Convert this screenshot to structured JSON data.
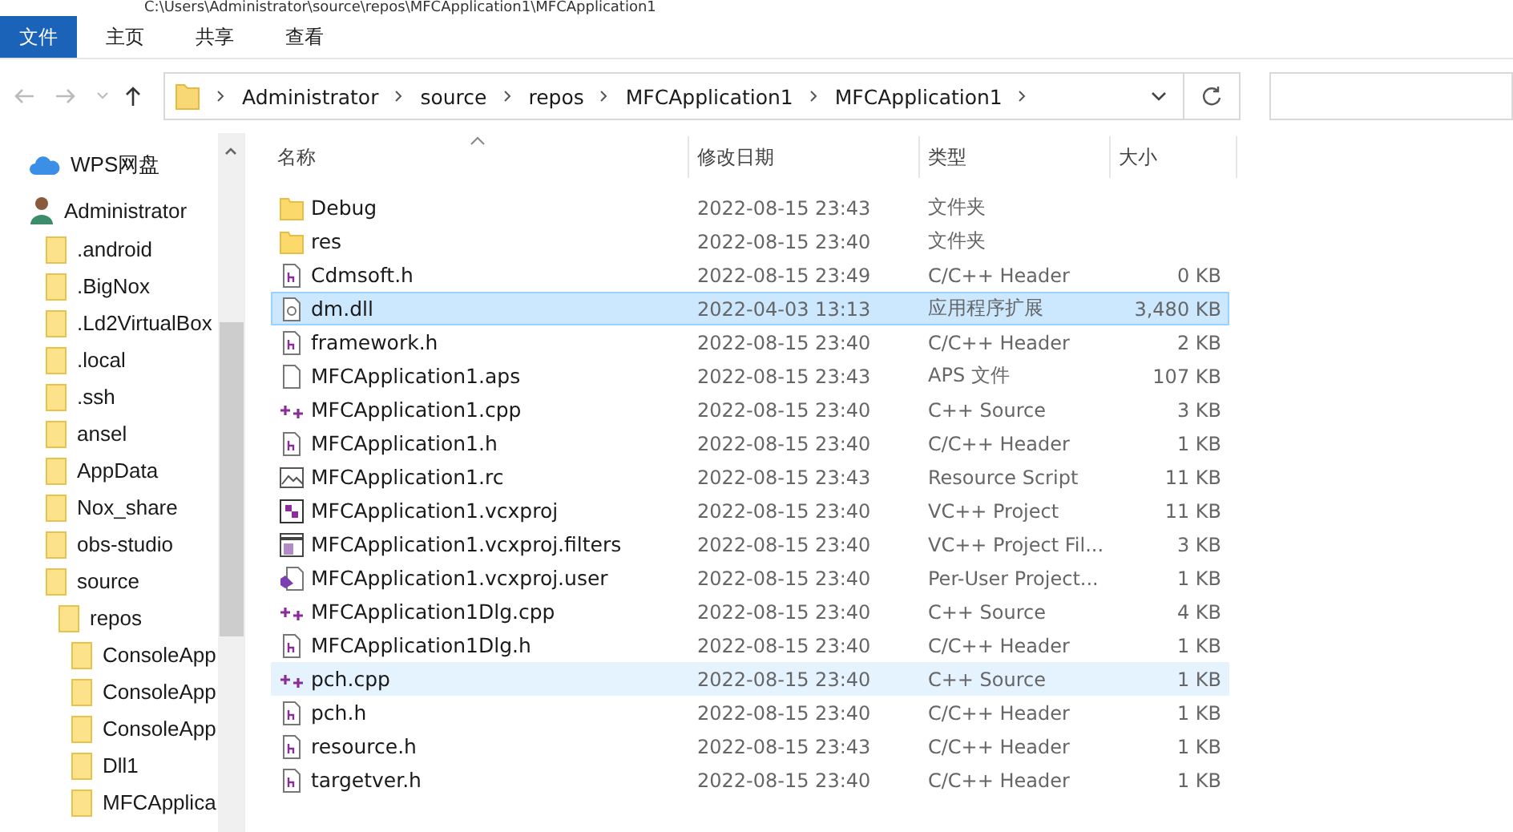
{
  "window": {
    "title": "C:\\Users\\Administrator\\source\\repos\\MFCApplication1\\MFCApplication1"
  },
  "ribbon_tabs": [
    {
      "label": "文件",
      "selected": true
    },
    {
      "label": "主页",
      "selected": false
    },
    {
      "label": "共享",
      "selected": false
    },
    {
      "label": "查看",
      "selected": false
    }
  ],
  "address_bar": {
    "crumbs": [
      "Administrator",
      "source",
      "repos",
      "MFCApplication1",
      "MFCApplication1"
    ]
  },
  "sidebar": {
    "items": [
      {
        "kind": "cloud",
        "label": "WPS网盘"
      },
      {
        "kind": "user",
        "label": "Administrator",
        "children": [
          {
            "kind": "folder",
            "label": ".android"
          },
          {
            "kind": "folder",
            "label": ".BigNox"
          },
          {
            "kind": "folder",
            "label": ".Ld2VirtualBox"
          },
          {
            "kind": "folder",
            "label": ".local"
          },
          {
            "kind": "folder",
            "label": ".ssh"
          },
          {
            "kind": "folder",
            "label": "ansel"
          },
          {
            "kind": "folder",
            "label": "AppData"
          },
          {
            "kind": "folder",
            "label": "Nox_share"
          },
          {
            "kind": "folder",
            "label": "obs-studio"
          },
          {
            "kind": "folder",
            "label": "source",
            "children": [
              {
                "kind": "folder",
                "label": "repos",
                "children": [
                  {
                    "kind": "folder",
                    "label": "ConsoleApp"
                  },
                  {
                    "kind": "folder",
                    "label": "ConsoleApp"
                  },
                  {
                    "kind": "folder",
                    "label": "ConsoleApp"
                  },
                  {
                    "kind": "folder",
                    "label": "Dll1"
                  },
                  {
                    "kind": "folder",
                    "label": "MFCApplica"
                  }
                ]
              }
            ]
          }
        ]
      }
    ]
  },
  "table": {
    "columns": [
      "名称",
      "修改日期",
      "类型",
      "大小"
    ],
    "rows": [
      {
        "kind": "folder",
        "name": "Debug",
        "date": "2022-08-15 23:43",
        "type": "文件夹",
        "size": "",
        "selected": false,
        "highlighted": false
      },
      {
        "kind": "folder",
        "name": "res",
        "date": "2022-08-15 23:40",
        "type": "文件夹",
        "size": "",
        "selected": false,
        "highlighted": false
      },
      {
        "kind": "header",
        "name": "Cdmsoft.h",
        "date": "2022-08-15 23:49",
        "type": "C/C++ Header",
        "size": "0 KB",
        "selected": false,
        "highlighted": false
      },
      {
        "kind": "dll",
        "name": "dm.dll",
        "date": "2022-04-03 13:13",
        "type": "应用程序扩展",
        "size": "3,480 KB",
        "selected": true,
        "highlighted": false
      },
      {
        "kind": "header",
        "name": "framework.h",
        "date": "2022-08-15 23:40",
        "type": "C/C++ Header",
        "size": "2 KB",
        "selected": false,
        "highlighted": false
      },
      {
        "kind": "file",
        "name": "MFCApplication1.aps",
        "date": "2022-08-15 23:43",
        "type": "APS 文件",
        "size": "107 KB",
        "selected": false,
        "highlighted": false
      },
      {
        "kind": "cpp",
        "name": "MFCApplication1.cpp",
        "date": "2022-08-15 23:40",
        "type": "C++ Source",
        "size": "3 KB",
        "selected": false,
        "highlighted": false
      },
      {
        "kind": "header",
        "name": "MFCApplication1.h",
        "date": "2022-08-15 23:40",
        "type": "C/C++ Header",
        "size": "1 KB",
        "selected": false,
        "highlighted": false
      },
      {
        "kind": "rc",
        "name": "MFCApplication1.rc",
        "date": "2022-08-15 23:43",
        "type": "Resource Script",
        "size": "11 KB",
        "selected": false,
        "highlighted": false
      },
      {
        "kind": "project",
        "name": "MFCApplication1.vcxproj",
        "date": "2022-08-15 23:40",
        "type": "VC++ Project",
        "size": "11 KB",
        "selected": false,
        "highlighted": false
      },
      {
        "kind": "filters",
        "name": "MFCApplication1.vcxproj.filters",
        "date": "2022-08-15 23:40",
        "type": "VC++ Project Fil...",
        "size": "3 KB",
        "selected": false,
        "highlighted": false
      },
      {
        "kind": "user",
        "name": "MFCApplication1.vcxproj.user",
        "date": "2022-08-15 23:40",
        "type": "Per-User Project...",
        "size": "1 KB",
        "selected": false,
        "highlighted": false
      },
      {
        "kind": "cpp",
        "name": "MFCApplication1Dlg.cpp",
        "date": "2022-08-15 23:40",
        "type": "C++ Source",
        "size": "4 KB",
        "selected": false,
        "highlighted": false
      },
      {
        "kind": "header",
        "name": "MFCApplication1Dlg.h",
        "date": "2022-08-15 23:40",
        "type": "C/C++ Header",
        "size": "1 KB",
        "selected": false,
        "highlighted": false
      },
      {
        "kind": "cpp",
        "name": "pch.cpp",
        "date": "2022-08-15 23:40",
        "type": "C++ Source",
        "size": "1 KB",
        "selected": false,
        "highlighted": true
      },
      {
        "kind": "header",
        "name": "pch.h",
        "date": "2022-08-15 23:40",
        "type": "C/C++ Header",
        "size": "1 KB",
        "selected": false,
        "highlighted": false
      },
      {
        "kind": "header",
        "name": "resource.h",
        "date": "2022-08-15 23:43",
        "type": "C/C++ Header",
        "size": "1 KB",
        "selected": false,
        "highlighted": false
      },
      {
        "kind": "header",
        "name": "targetver.h",
        "date": "2022-08-15 23:40",
        "type": "C/C++ Header",
        "size": "1 KB",
        "selected": false,
        "highlighted": false
      }
    ]
  }
}
